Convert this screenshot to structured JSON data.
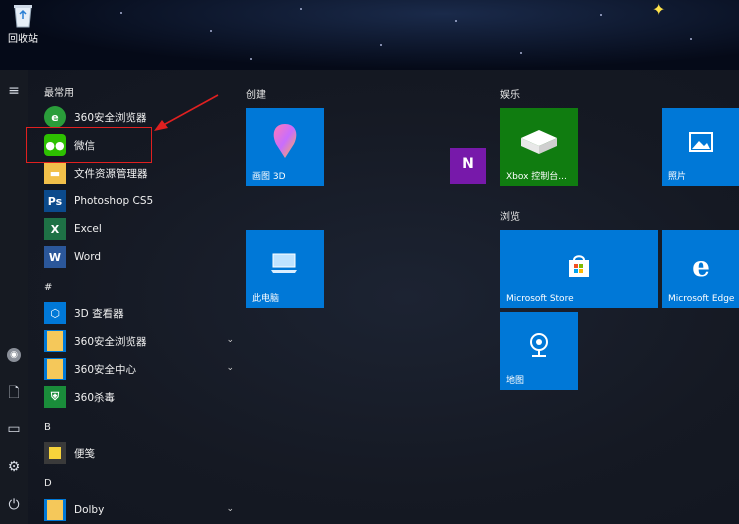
{
  "desktop": {
    "recycle_bin_label": "回收站"
  },
  "list": {
    "section_frequent": "最常用",
    "frequent": [
      {
        "label": "360安全浏览器",
        "icon": "360-browser-icon"
      },
      {
        "label": "微信",
        "icon": "wechat-icon"
      },
      {
        "label": "文件资源管理器",
        "icon": "file-explorer-icon"
      },
      {
        "label": "Photoshop CS5",
        "icon": "photoshop-icon",
        "icon_text": "Ps"
      },
      {
        "label": "Excel",
        "icon": "excel-icon",
        "icon_text": "X"
      },
      {
        "label": "Word",
        "icon": "word-icon",
        "icon_text": "W"
      }
    ],
    "section_hash": "#",
    "hash_items": [
      {
        "label": "3D 查看器",
        "icon": "3d-viewer-icon"
      },
      {
        "label": "360安全浏览器",
        "icon": "folder-icon"
      },
      {
        "label": "360安全中心",
        "icon": "folder-icon"
      },
      {
        "label": "360杀毒",
        "icon": "360-antivirus-icon"
      }
    ],
    "section_b": "B",
    "b_items": [
      {
        "label": "便笺",
        "icon": "sticky-notes-icon"
      }
    ],
    "section_d": "D",
    "d_items": [
      {
        "label": "Dolby",
        "icon": "folder-icon"
      }
    ]
  },
  "groups": {
    "create": "创建",
    "entertainment": "娱乐",
    "browse": "浏览"
  },
  "tiles": {
    "paint3d": "画图 3D",
    "thispc": "此电脑",
    "onenote": "N",
    "xbox": "Xbox 控制台...",
    "photos": "照片",
    "store": "Microsoft Store",
    "edge": "Microsoft Edge",
    "maps": "地图"
  },
  "colors": {
    "tile_blue": "#0078d7",
    "xbox_green": "#107c10",
    "onenote_purple": "#7719aa",
    "highlight_red": "#e02020"
  }
}
